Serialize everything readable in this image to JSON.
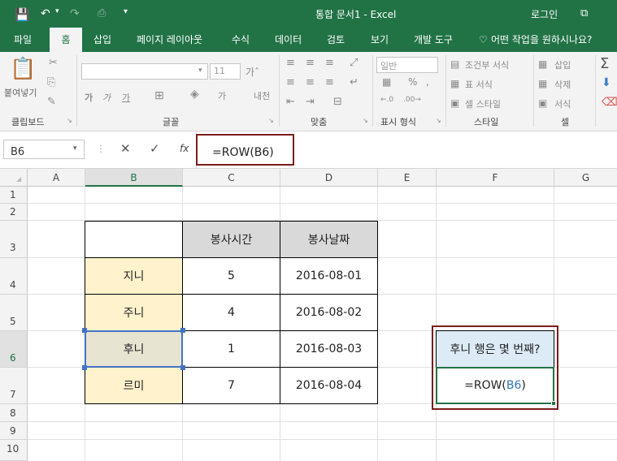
{
  "title_bar": {
    "title": "통합 문서1 - Excel",
    "login": "로그인"
  },
  "tabs": [
    "파일",
    "홈",
    "삽입",
    "페이지 레이아웃",
    "수식",
    "데이터",
    "검토",
    "보기",
    "개발 도구",
    "어떤 작업을 원하시나요?"
  ],
  "ribbon": {
    "paste": "붙여넣기",
    "font_size": "11",
    "number_format": "일반",
    "style_items": [
      "조건부 서식",
      "표 서식",
      "셀 스타일"
    ],
    "cell_items": [
      "삽입",
      "삭제",
      "서식"
    ],
    "groups": [
      "클립보드",
      "글꼴",
      "맞춤",
      "표시 형식",
      "스타일",
      "셀"
    ]
  },
  "formula_bar": {
    "name_box": "B6",
    "formula": "=ROW(B6)",
    "fx": "fx"
  },
  "columns": [
    "A",
    "B",
    "C",
    "D",
    "E",
    "F",
    "G"
  ],
  "rows": [
    "1",
    "2",
    "3",
    "4",
    "5",
    "6",
    "7",
    "8",
    "9",
    "10"
  ],
  "table": {
    "headers": [
      "봉사시간",
      "봉사날짜"
    ],
    "rows": [
      {
        "name": "지니",
        "hours": "5",
        "date": "2016-08-01"
      },
      {
        "name": "주니",
        "hours": "4",
        "date": "2016-08-02"
      },
      {
        "name": "후니",
        "hours": "1",
        "date": "2016-08-03"
      },
      {
        "name": "르미",
        "hours": "7",
        "date": "2016-08-04"
      }
    ]
  },
  "question": {
    "label": "후니 행은 몇 번째?",
    "formula_prefix": "=ROW(",
    "formula_ref": "B6",
    "formula_suffix": ")"
  },
  "colors": {
    "excel_green": "#217346",
    "name_fill": "#fff2cc",
    "header_fill": "#d9d9d9",
    "question_fill": "#ddebf7",
    "highlight_border": "#7b1c1c",
    "ref_blue": "#2e75b6"
  }
}
